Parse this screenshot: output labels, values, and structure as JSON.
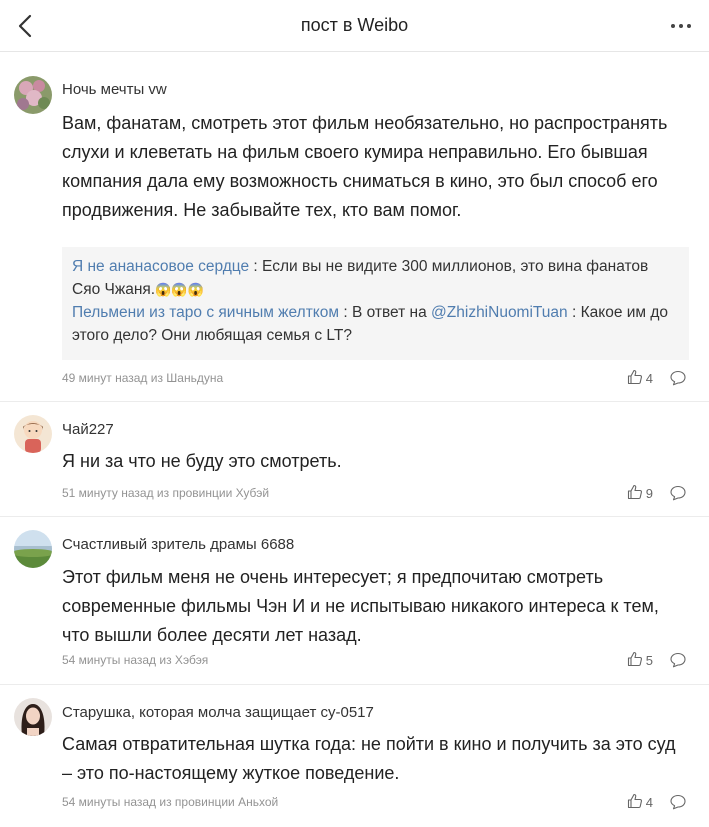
{
  "header": {
    "title": "пост в Weibo"
  },
  "comments": [
    {
      "author": "Ночь мечты vw",
      "text": "Вам, фанатам, смотреть этот фильм необязательно, но распространять слухи и клеветать на фильм своего кумира неправильно. Его бывшая компания дала ему возможность сниматься в кино, это был способ его продвижения. Не забывайте тех, кто вам помог.",
      "meta": "49 минут назад из Шаньдуна",
      "likes": "4",
      "replies": [
        {
          "author": "Я не ананасовое сердце",
          "sep": " : ",
          "text": "Если вы не видите 300 миллионов, это вина фанатов Сяо Чжаня.",
          "emoji": "😱😱😱"
        },
        {
          "author": "Пельмени из таро с яичным желтком",
          "sep": " : ",
          "text_pre": "В ответ на ",
          "mention": "@ZhizhiNuomiTuan",
          "text_post": " : Какое им до этого дело? Они любящая семья с LT?"
        }
      ]
    },
    {
      "author": "Чай227",
      "text": "Я ни за что не буду это смотреть.",
      "meta": "51 минуту назад из провинции Хубэй",
      "likes": "9"
    },
    {
      "author": "Счастливый зритель драмы 6688",
      "text": "Этот фильм меня не очень интересует; я предпочитаю смотреть современные фильмы Чэн И и не испытываю никакого интереса к тем, что вышли более десяти лет назад.",
      "meta": "54 минуты назад из Хэбэя",
      "likes": "5"
    },
    {
      "author": "Старушка, которая молча защищает су-0517",
      "text": "Самая отвратительная шутка года: не пойти в кино и получить за это суд – это по-настоящему жуткое поведение.",
      "meta": "54 минуты назад из провинции Аньхой",
      "likes": "4"
    }
  ]
}
